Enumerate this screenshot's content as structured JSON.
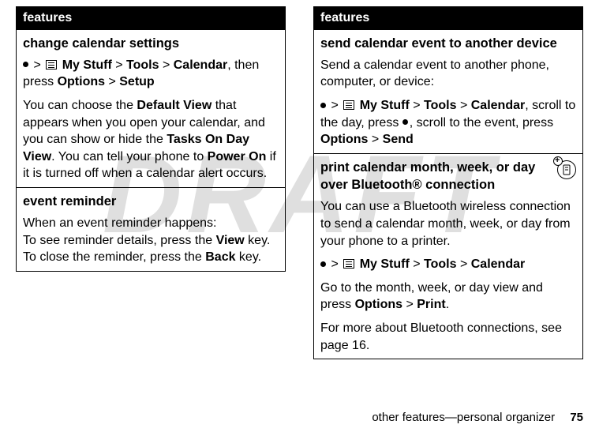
{
  "watermark": "DRAFT",
  "left": {
    "header": "features",
    "row1": {
      "title": "change calendar settings",
      "path_mystuff": "My Stuff",
      "path_tools": "Tools",
      "path_calendar": "Calendar",
      "path_tail": ", then press",
      "path_options": "Options",
      "path_setup": "Setup",
      "desc_pre": "You can choose the ",
      "desc_defview": "Default View",
      "desc_mid1": " that appears when you open your calendar, and you can show or hide the ",
      "desc_tasks": "Tasks On Day View",
      "desc_mid2": ". You can tell your phone to ",
      "desc_poweron": "Power On",
      "desc_tail": " if it is turned off when a calendar alert occurs."
    },
    "row2": {
      "title": "event reminder",
      "line1": "When an event reminder happens:",
      "line2_pre": "To see reminder details, press the ",
      "line2_view": "View",
      "line2_post": " key.",
      "line3_pre": "To close the reminder, press the ",
      "line3_back": "Back",
      "line3_post": " key."
    }
  },
  "right": {
    "header": "features",
    "row1": {
      "title": "send calendar event to another device",
      "intro": "Send a calendar event to another phone, computer, or device:",
      "path_mystuff": "My Stuff",
      "path_tools": "Tools",
      "path_calendar": "Calendar",
      "path_mid1": ", scroll to the day, press ",
      "path_mid2": ", scroll to the event, press",
      "path_options": "Options",
      "path_send": "Send"
    },
    "row2": {
      "title": "print calendar month, week, or day over Bluetooth® connection",
      "intro": "You can use a Bluetooth wireless connection to send a calendar month, week, or day from your phone to a printer.",
      "path_mystuff": "My Stuff",
      "path_tools": "Tools",
      "path_calendar": "Calendar",
      "desc_pre": "Go to the month, week, or day view and press ",
      "desc_options": "Options",
      "desc_print": "Print",
      "more": "For more about Bluetooth connections, see page 16."
    }
  },
  "footer": {
    "text": "other features—personal organizer",
    "page": "75"
  }
}
